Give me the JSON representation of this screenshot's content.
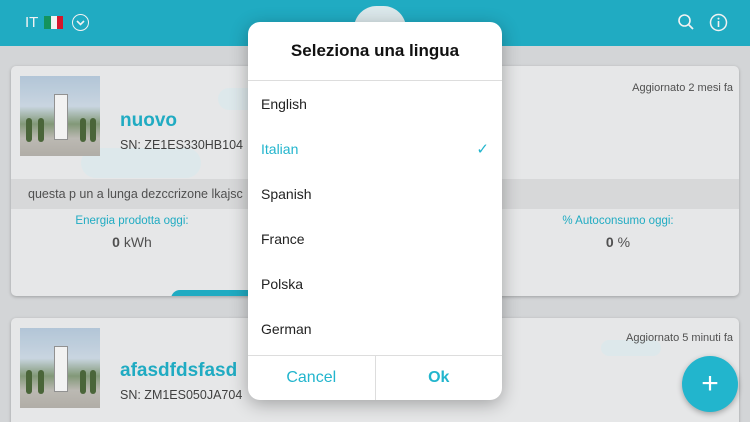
{
  "header": {
    "lang_code": "IT",
    "lang_flag": "italy-flag-icon",
    "icons": [
      "chevron-down-circle-icon",
      "search-icon",
      "info-icon"
    ]
  },
  "cards": [
    {
      "name": "nuovo",
      "sn": "SN: ZE1ES330HB104",
      "updated": "Aggiornato 2 mesi fa",
      "description": "questa p un a lunga dezccrizone lkajsc",
      "energy_label": "Energia prodotta oggi:",
      "energy_value": "0",
      "energy_unit": "kWh",
      "autoconsumo_label": "% Autoconsumo oggi:",
      "autoconsumo_value": "0",
      "autoconsumo_unit": "%"
    },
    {
      "name": "afasdfdsfasd",
      "sn": "SN: ZM1ES050JA704",
      "updated": "Aggiornato 5 minuti fa"
    }
  ],
  "dialog": {
    "title": "Seleziona una lingua",
    "options": [
      "English",
      "Italian",
      "Spanish",
      "France",
      "Polska",
      "German"
    ],
    "selected": "Italian",
    "cancel_label": "Cancel",
    "ok_label": "Ok"
  },
  "fab": {
    "label": "+"
  },
  "colors": {
    "accent": "#22b5cd",
    "background": "#dfe1e3"
  }
}
